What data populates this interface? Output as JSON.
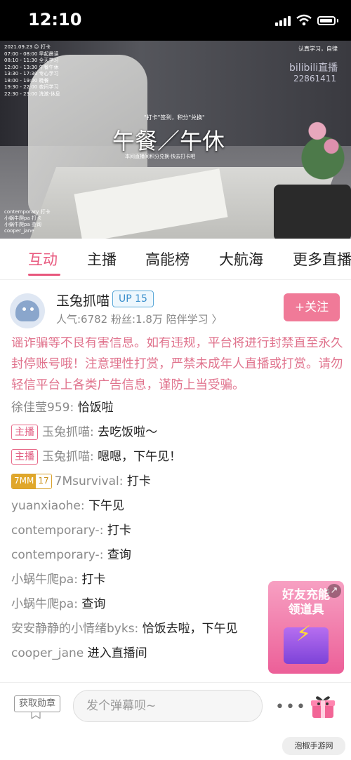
{
  "status_bar": {
    "time": "12:10"
  },
  "video": {
    "overlay_lines": [
      "2021.09.23  ☺ 打卡",
      "07:00 - 08:00 早起晨读",
      "08:10 - 11:30 全天学习",
      "12:00 - 13:30 午餐午休",
      "13:30 - 17:30 专心学习",
      "18:00 - 19:00 晚餐",
      "19:30 - 22:00 夜间学习",
      "22:30 - 23:00 洗漱·休息"
    ],
    "overlay_foot": [
      "contemporary  打卡",
      "小蜗牛爬pa  打卡",
      "小蜗牛爬pa  查询",
      "cooper_jane"
    ],
    "right_note": "认真学习，自律",
    "brand": "bilibili直播",
    "room_id": "22861411",
    "title_top": "\"打卡\"签到，积分\"兑换\"",
    "title": "午餐／午休",
    "title_sub": "本间直播间积分兑换·快去打卡吧"
  },
  "tabs": [
    {
      "label": "互动",
      "active": true
    },
    {
      "label": "主播",
      "active": false
    },
    {
      "label": "高能榜",
      "active": false
    },
    {
      "label": "大航海",
      "active": false
    },
    {
      "label": "更多直播",
      "active": false
    }
  ],
  "streamer": {
    "name": "玉兔抓喵",
    "level": "UP 15",
    "meta": "人气:6782   粉丝:1.8万   陪伴学习 〉",
    "follow_label": "+关注"
  },
  "chat": {
    "notice": "谣诈骗等不良有害信息。如有违规，平台将进行封禁直至永久封停账号哦！注意理性打赏，严禁未成年人直播或打赏。请勿轻信平台上各类广告信息，谨防上当受骗。",
    "host_badge": "主播",
    "messages": [
      {
        "user": "徐佳莹959:",
        "text": " 恰饭啦"
      },
      {
        "host": true,
        "user": "玉兔抓喵:",
        "text": " 去吃饭啦～"
      },
      {
        "host": true,
        "user": "玉兔抓喵:",
        "text": " 嗯嗯，下午见！"
      },
      {
        "medal_name": "7MM",
        "medal_level": "17",
        "user": "7Msurvival:",
        "text": " 打卡"
      },
      {
        "user": "yuanxiaohe:",
        "text": " 下午见"
      },
      {
        "user": "contemporary-:",
        "text": " 打卡"
      },
      {
        "user": "contemporary-:",
        "text": " 查询"
      },
      {
        "user": "小蜗牛爬pa:",
        "text": " 打卡"
      },
      {
        "user": "小蜗牛爬pa:",
        "text": " 查询"
      },
      {
        "user": "安安静静的小情绪byks:",
        "text": " 恰饭去啦，下午见"
      },
      {
        "user": "cooper_jane",
        "text": " 进入直播间"
      }
    ]
  },
  "promo": {
    "line1": "好友充能",
    "line2": "领道具"
  },
  "bottom": {
    "medal_button": "获取勋章",
    "input_placeholder": "发个弹幕呗~",
    "watermark": "泡椒手游网"
  }
}
